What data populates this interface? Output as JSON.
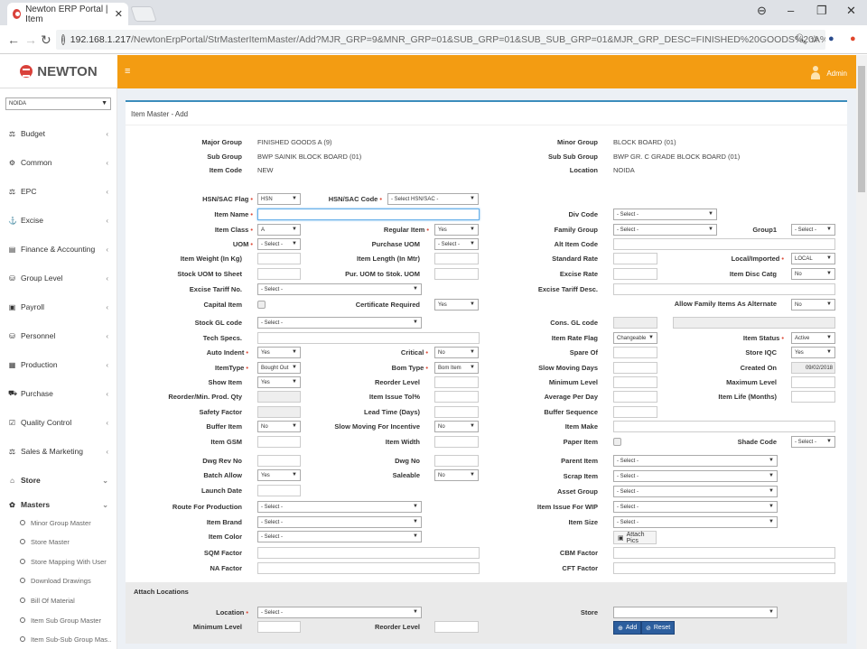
{
  "browser": {
    "tab_title": "Newton ERP Portal | Item",
    "url_host": "192.168.1.217",
    "url_path": "/NewtonErpPortal/StrMasterItemMaster/Add?MJR_GRP=9&MNR_GRP=01&SUB_GRP=01&SUB_SUB_GRP=01&MJR_GRP_DESC=FINISHED%20GOODS%20A%20(9)&M..."
  },
  "app": {
    "logo_text": "NEWTON",
    "user": "Admin",
    "accent": "#f39c12",
    "primary": "#3c8dbc"
  },
  "sidebar": {
    "branch": "NOIDA",
    "items": [
      {
        "label": "Budget",
        "icon": "scale-icon"
      },
      {
        "label": "Common",
        "icon": "gears-icon"
      },
      {
        "label": "EPC",
        "icon": "scale-icon"
      },
      {
        "label": "Excise",
        "icon": "anchor-icon"
      },
      {
        "label": "Finance & Accounting",
        "icon": "calculator-icon"
      },
      {
        "label": "Group Level",
        "icon": "sitemap-icon"
      },
      {
        "label": "Payroll",
        "icon": "money-icon"
      },
      {
        "label": "Personnel",
        "icon": "sitemap-icon"
      },
      {
        "label": "Production",
        "icon": "industry-icon"
      },
      {
        "label": "Purchase",
        "icon": "cart-icon"
      },
      {
        "label": "Quality Control",
        "icon": "check-square-icon"
      },
      {
        "label": "Sales & Marketing",
        "icon": "scale-icon"
      },
      {
        "label": "Store",
        "icon": "bank-icon"
      },
      {
        "label": "Masters",
        "icon": "gear-icon"
      }
    ],
    "subitems": [
      "Minor Group Master",
      "Store Master",
      "Store Mapping With User",
      "Download Drawings",
      "Bill Of Material",
      "Item Sub Group Master",
      "Item Sub-Sub Group Mas.."
    ]
  },
  "page": {
    "title": "Item Master - Add"
  },
  "info": {
    "major_group_label": "Major Group",
    "major_group": "FINISHED GOODS A (9)",
    "sub_group_label": "Sub Group",
    "sub_group": "BWP SAINIK BLOCK BOARD (01)",
    "item_code_label": "Item Code",
    "item_code": "NEW",
    "minor_group_label": "Minor Group",
    "minor_group": "BLOCK BOARD (01)",
    "sub_sub_group_label": "Sub Sub Group",
    "sub_sub_group": "BWP GR. C GRADE BLOCK BOARD (01)",
    "location_label": "Location",
    "location": "NOIDA"
  },
  "labels": {
    "hsn_flag": "HSN/SAC Flag",
    "hsn_code": "HSN/SAC Code",
    "item_name": "Item Name",
    "div_code": "Div Code",
    "item_class": "Item Class",
    "regular_item": "Regular Item",
    "family_group": "Family Group",
    "group1": "Group1",
    "uom": "UOM",
    "purchase_uom": "Purchase UOM",
    "alt_item_code": "Alt Item Code",
    "item_weight": "Item Weight (In Kg)",
    "item_length": "Item Length (In Mtr)",
    "standard_rate": "Standard Rate",
    "local_imported": "Local/Imported",
    "stock_uom_sheet": "Stock UOM to Sheet",
    "pur_uom_stok": "Pur. UOM to Stok. UOM",
    "excise_rate": "Excise Rate",
    "item_disc_catg": "Item Disc Catg",
    "excise_tariff_no": "Excise Tariff No.",
    "excise_tariff_desc": "Excise Tariff Desc.",
    "capital_item": "Capital Item",
    "certificate_required": "Certificate Required",
    "allow_family": "Allow Family Items As Alternate",
    "stock_gl": "Stock GL code",
    "cons_gl": "Cons. GL code",
    "tech_specs": "Tech Specs.",
    "item_rate_flag": "Item Rate Flag",
    "item_status": "Item Status",
    "auto_indent": "Auto Indent",
    "critical": "Critical",
    "spare_of": "Spare Of",
    "store_iqc": "Store IQC",
    "item_type": "ItemType",
    "bom_type": "Bom Type",
    "slow_moving_days": "Slow Moving Days",
    "created_on": "Created On",
    "show_item": "Show Item",
    "reorder_level": "Reorder Level",
    "minimum_level": "Minimum Level",
    "maximum_level": "Maximum Level",
    "reorder_min_qty": "Reorder/Min. Prod. Qty",
    "item_issue_tol": "Item Issue Tol%",
    "average_per_day": "Average Per Day",
    "item_life": "Item Life (Months)",
    "safety_factor": "Safety Factor",
    "lead_time": "Lead Time (Days)",
    "buffer_sequence": "Buffer Sequence",
    "buffer_item": "Buffer Item",
    "slow_moving_incentive": "Slow Moving For Incentive",
    "item_make": "Item Make",
    "item_gsm": "Item GSM",
    "item_width": "Item Width",
    "paper_item": "Paper Item",
    "shade_code": "Shade Code",
    "dwg_rev_no": "Dwg Rev No",
    "dwg_no": "Dwg No",
    "parent_item": "Parent Item",
    "batch_allow": "Batch Allow",
    "saleable": "Saleable",
    "scrap_item": "Scrap Item",
    "launch_date": "Launch Date",
    "asset_group": "Asset Group",
    "route_production": "Route For Production",
    "item_issue_wip": "Item Issue For WIP",
    "item_brand": "Item Brand",
    "item_size": "Item Size",
    "item_color": "Item Color",
    "sqm_factor": "SQM Factor",
    "cbm_factor": "CBM Factor",
    "na_factor": "NA Factor",
    "cft_factor": "CFT Factor"
  },
  "values": {
    "hsn_flag": "HSN",
    "hsn_code": "- Select HSN/SAC -",
    "div_code": "- Select -",
    "item_class": "A",
    "regular_item": "Yes",
    "family_group": "- Select -",
    "group1": "- Select -",
    "uom": "- Select -",
    "purchase_uom": "- Select -",
    "local_imported": "LOCAL",
    "item_disc_catg": "No",
    "excise_tariff_no": "- Select -",
    "certificate_required": "Yes",
    "allow_family": "No",
    "stock_gl": "- Select -",
    "item_rate_flag": "Changeable",
    "item_status": "Active",
    "auto_indent": "Yes",
    "critical": "No",
    "store_iqc": "Yes",
    "item_type": "Bought Out",
    "bom_type": "Bom Item",
    "created_on": "09/02/2018",
    "show_item": "Yes",
    "buffer_item": "No",
    "slow_moving_incentive": "No",
    "shade_code": "- Select -",
    "parent_item": "- Select -",
    "batch_allow": "Yes",
    "saleable": "No",
    "scrap_item": "- Select -",
    "asset_group": "- Select -",
    "route_production": "- Select -",
    "item_issue_wip": "- Select -",
    "item_brand": "- Select -",
    "item_size": "- Select -",
    "item_color": "- Select -",
    "attach_pics": "Attach Pics"
  },
  "attach": {
    "section_title": "Attach Locations",
    "location_label": "Location",
    "location_value": "- Select -",
    "store_label": "Store",
    "min_level_label": "Minimum Level",
    "reorder_level_label": "Reorder Level",
    "add_label": "Add",
    "reset_label": "Reset"
  }
}
